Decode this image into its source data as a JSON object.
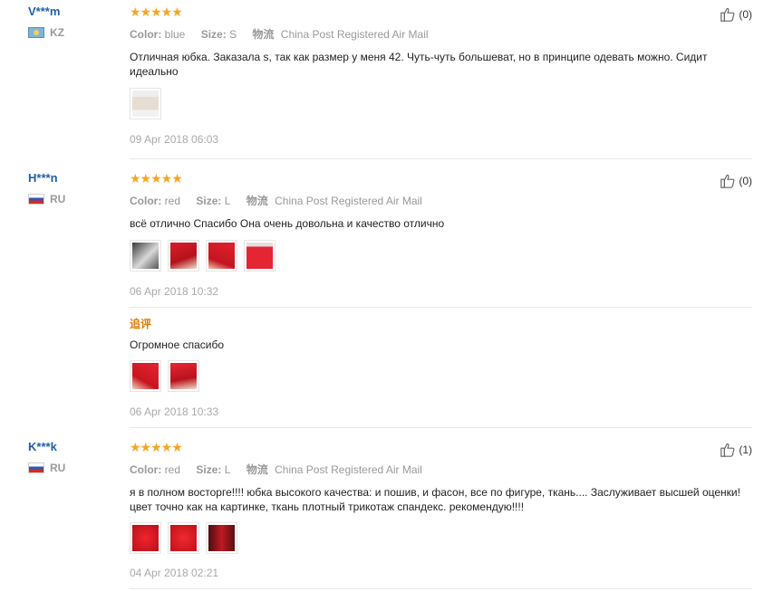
{
  "reviews": [
    {
      "user": "V***m",
      "country": "KZ",
      "stars": "★★★★★",
      "color_label": "Color:",
      "color_value": "blue",
      "size_label": "Size:",
      "size_value": "S",
      "shipping_label": "物流",
      "shipping_value": "China Post Registered Air Mail",
      "helpful_count": "(0)",
      "text": "Отличная юбка. Заказала s, так как размер у меня 42. Чуть-чуть большеват, но в принципе одевать можно. Сидит идеально",
      "date": "09 Apr 2018 06:03"
    },
    {
      "user": "H***n",
      "country": "RU",
      "stars": "★★★★★",
      "color_label": "Color:",
      "color_value": "red",
      "size_label": "Size:",
      "size_value": "L",
      "shipping_label": "物流",
      "shipping_value": "China Post Registered Air Mail",
      "helpful_count": "(0)",
      "text": "всё отлично Спасибо Она очень довольна и качество отлично",
      "date": "06 Apr 2018 10:32",
      "followup_label": "追评",
      "followup_text": "Огромное спасибо",
      "followup_date": "06 Apr 2018 10:33"
    },
    {
      "user": "K***k",
      "country": "RU",
      "stars": "★★★★★",
      "color_label": "Color:",
      "color_value": "red",
      "size_label": "Size:",
      "size_value": "L",
      "shipping_label": "物流",
      "shipping_value": "China Post Registered Air Mail",
      "helpful_count": "(1)",
      "text": "я в полном восторге!!!! юбка высокого качества: и пошив, и фасон, все по фигуре, ткань.... Заслуживает высшей оценки! цвет точно как на картинке, ткань плотный трикотаж спандекс. рекомендую!!!!",
      "date": "04 Apr 2018 02:21"
    }
  ],
  "icons": {
    "helpful": "thumbs-up-icon"
  },
  "colors": {
    "username": "#1f5fa8",
    "stars": "#f5a623",
    "followup_label": "#e07a00"
  }
}
